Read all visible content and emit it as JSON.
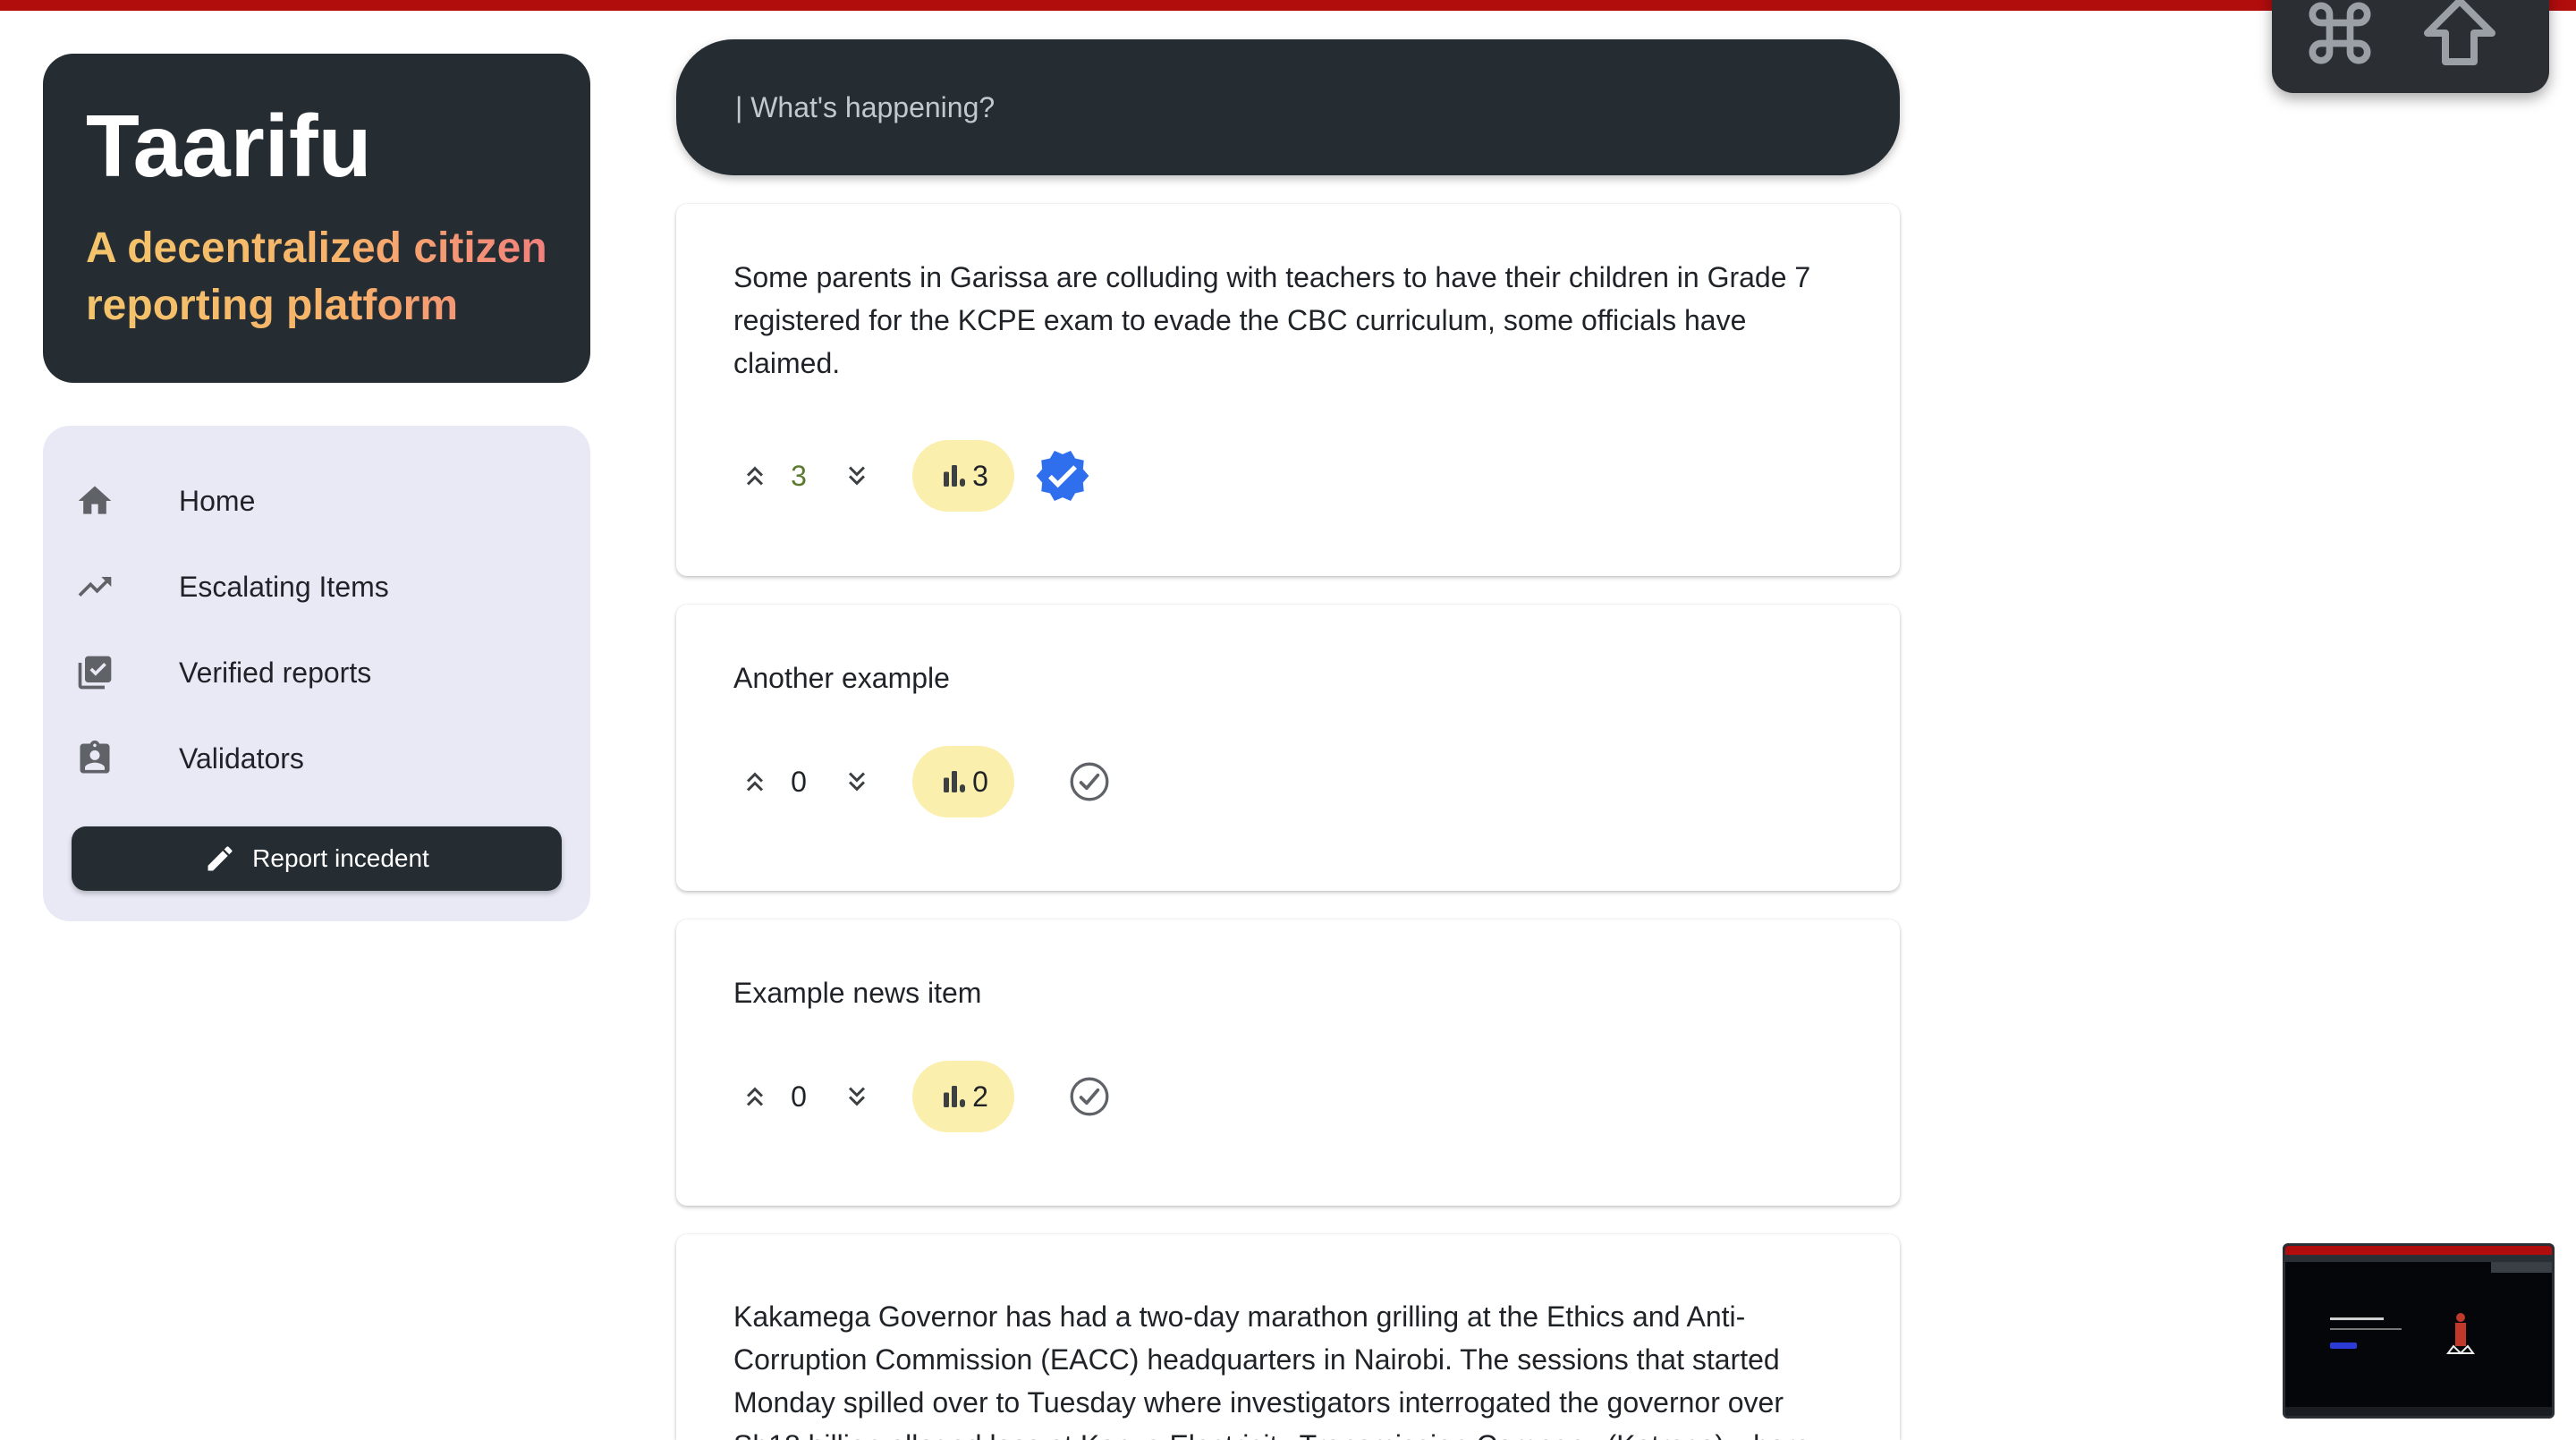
{
  "brand": {
    "title": "Taarifu",
    "subtitle": "A decentralized citizen reporting platform"
  },
  "nav": {
    "items": [
      {
        "label": "Home",
        "icon": "home-icon"
      },
      {
        "label": "Escalating Items",
        "icon": "trending-up-icon"
      },
      {
        "label": "Verified reports",
        "icon": "verified-list-icon"
      },
      {
        "label": "Validators",
        "icon": "badge-icon"
      }
    ],
    "report_button": "Report incedent"
  },
  "compose": {
    "placeholder": "| What's happening?"
  },
  "posts": [
    {
      "text": "Some parents in Garissa are colluding with teachers to have their children in Grade 7 registered for the KCPE exam to evade the CBC curriculum, some officials have claimed.",
      "votes": "3",
      "stats": "3",
      "verified": true
    },
    {
      "text": "Another example",
      "votes": "0",
      "stats": "0",
      "verified": false
    },
    {
      "text": "Example news item",
      "votes": "0",
      "stats": "2",
      "verified": false
    },
    {
      "text": "Kakamega Governor has had a two-day marathon grilling at the Ethics and Anti-Corruption Commission (EACC) headquarters in Nairobi. The sessions that started Monday spilled over to Tuesday where investigators interrogated the governor over Sh18 billion alleged loss at Kenya Electricity Transmission Company (Ketraco) where he"
    }
  ],
  "colors": {
    "dark": "#252d33",
    "accent_red": "#b10d0d",
    "nav_bg": "#e8e9f5",
    "pill_bg": "#fbefae",
    "verified_blue": "#2f6fed",
    "positive_count": "#5a7a2e"
  }
}
